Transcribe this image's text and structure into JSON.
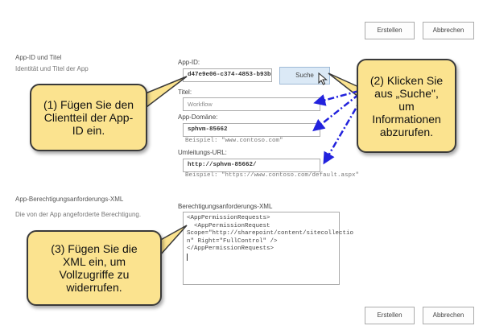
{
  "toolbar_top": {
    "create_label": "Erstellen",
    "cancel_label": "Abbrechen"
  },
  "toolbar_bottom": {
    "create_label": "Erstellen",
    "cancel_label": "Abbrechen"
  },
  "section_identity": {
    "title": "App-ID und Titel",
    "description": "Identität und Titel der App",
    "app_id_label": "App-ID:",
    "app_id_value": "d47e9e06-c374-4853-b93b-",
    "search_button_label": "Suche",
    "title_label": "Titel:",
    "title_value": "Workflow",
    "domain_label": "App-Domäne:",
    "domain_value": "sphvm-85662",
    "domain_example": "Beispiel: \"www.contoso.com\"",
    "redirect_label": "Umleitungs-URL:",
    "redirect_value": "http://sphvm-85662/",
    "redirect_example": "Beispiel: \"https://www.contoso.com/default.aspx\""
  },
  "section_permissions": {
    "title": "App-Berechtigungsanforderungs-XML",
    "description": "Die von der App angeforderte Berechtigung.",
    "xml_label": "Berechtigungsanforderungs-XML",
    "xml_lines": [
      "<AppPermissionRequests>",
      "  <AppPermissionRequest",
      "Scope=\"http://sharepoint/content/sitecollectio",
      "n\" Right=\"FullControl\" />",
      "</AppPermissionRequests>"
    ]
  },
  "callouts": {
    "step1": "(1) Fügen Sie den Clientteil der App-ID ein.",
    "step2": "(2) Klicken Sie aus „Suche\", um Informationen abzurufen.",
    "step3": "(3) Fügen Sie die XML ein, um Vollzugriffe zu widerrufen."
  },
  "colors": {
    "callout_fill": "#fbe38f",
    "arrow_blue": "#2222dd",
    "search_button": "#dbe9f6"
  }
}
